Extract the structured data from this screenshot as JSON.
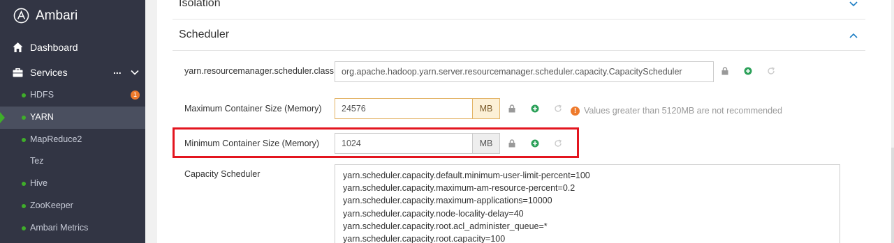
{
  "brand": {
    "name": "Ambari"
  },
  "sidebar": {
    "dashboard_label": "Dashboard",
    "services_label": "Services",
    "services_more": "...",
    "items": [
      {
        "label": "HDFS",
        "status": "green",
        "badge": "1"
      },
      {
        "label": "YARN",
        "status": "green",
        "active": true
      },
      {
        "label": "MapReduce2",
        "status": "green"
      },
      {
        "label": "Tez",
        "status": "none"
      },
      {
        "label": "Hive",
        "status": "green"
      },
      {
        "label": "ZooKeeper",
        "status": "green"
      },
      {
        "label": "Ambari Metrics",
        "status": "green"
      }
    ]
  },
  "sections": {
    "isolation_title": "Isolation",
    "scheduler_title": "Scheduler"
  },
  "configs": {
    "scheduler_class": {
      "label": "yarn.resourcemanager.scheduler.class",
      "value": "org.apache.hadoop.yarn.server.resourcemanager.scheduler.capacity.CapacityScheduler"
    },
    "max_container": {
      "label": "Maximum Container Size (Memory)",
      "value": "24576",
      "unit": "MB",
      "warning": "Values greater than 5120MB are not recommended"
    },
    "min_container": {
      "label": "Minimum Container Size (Memory)",
      "value": "1024",
      "unit": "MB"
    },
    "capacity_scheduler": {
      "label": "Capacity Scheduler",
      "lines": [
        "yarn.scheduler.capacity.default.minimum-user-limit-percent=100",
        "yarn.scheduler.capacity.maximum-am-resource-percent=0.2",
        "yarn.scheduler.capacity.maximum-applications=10000",
        "yarn.scheduler.capacity.node-locality-delay=40",
        "yarn.scheduler.capacity.root.acl_administer_queue=*",
        "yarn.scheduler.capacity.root.capacity=100"
      ]
    }
  },
  "colors": {
    "sidebar_bg": "#323544",
    "status_green": "#3fae2a",
    "warning_orange": "#ee7a2c",
    "highlight_red": "#e3151f",
    "link_blue": "#1f7fc4"
  }
}
